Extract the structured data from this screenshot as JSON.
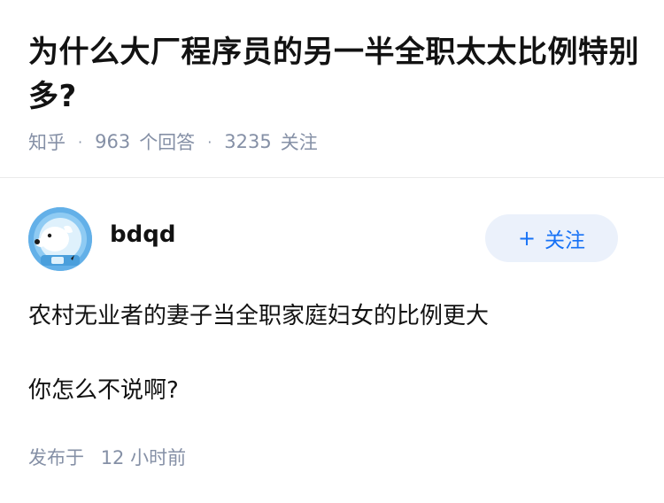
{
  "question": {
    "title": "为什么大厂程序员的另一半全职太太比例特别多?",
    "source": "知乎",
    "separator": "·",
    "answer_count": "963",
    "answer_unit": "个回答",
    "follower_count": "3235",
    "follower_unit": "关注"
  },
  "answer": {
    "author_name": "bdqd",
    "avatar_icon": "astronaut-dog-avatar",
    "follow_button": {
      "plus": "+",
      "label": "关注"
    },
    "paragraphs": [
      "农村无业者的妻子当全职家庭妇女的比例更大",
      "你怎么不说啊?"
    ],
    "published_label": "发布于",
    "published_time": "12 小时前"
  },
  "colors": {
    "text_primary": "#121212",
    "text_secondary": "#8590a6",
    "accent_blue": "#1772f6",
    "follow_bg": "#ebf1fb",
    "divider": "#ebebeb"
  }
}
